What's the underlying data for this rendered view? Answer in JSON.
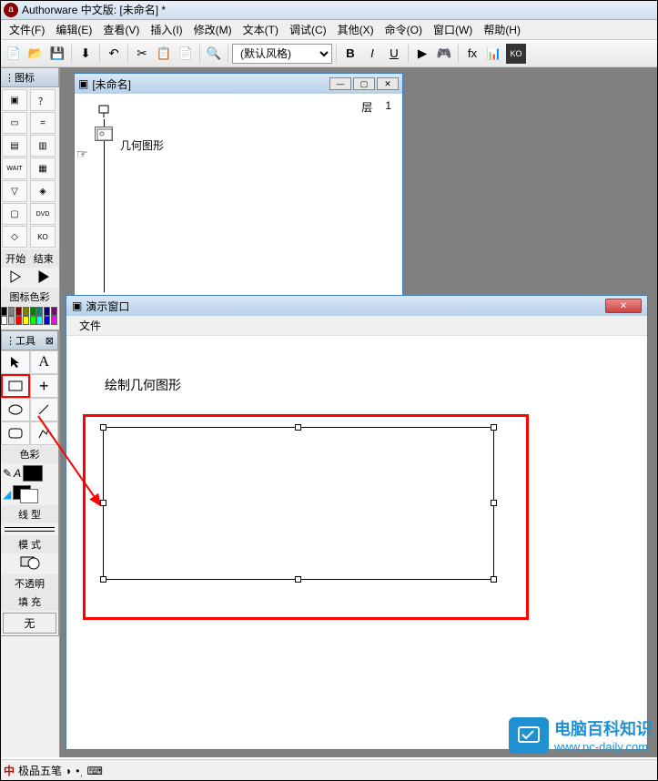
{
  "title": "Authorware 中文版: [未命名] *",
  "menus": [
    "文件(F)",
    "编辑(E)",
    "查看(V)",
    "插入(I)",
    "修改(M)",
    "文本(T)",
    "调试(C)",
    "其他(X)",
    "命令(O)",
    "窗口(W)",
    "帮助(H)"
  ],
  "style_select": "(默认风格)",
  "sidebar": {
    "icons_title": "图标",
    "start_end": {
      "start": "开始",
      "end": "结束"
    },
    "color_title": "图标色彩",
    "tools_title": "工具",
    "section_color": "色彩",
    "section_line": "线 型",
    "section_mode": "模 式",
    "mode_label": "不透明",
    "section_fill": "填 充",
    "fill_label": "无"
  },
  "flow_window": {
    "title": "[未命名]",
    "layer_label": "层",
    "layer_value": "1",
    "icon_label": "几何图形"
  },
  "demo_window": {
    "title": "演示窗口",
    "menu_file": "文件",
    "canvas_heading": "绘制几何图形"
  },
  "statusbar": {
    "ime": "极品五笔"
  },
  "watermark": {
    "cn": "电脑百科知识",
    "url": "www.pc-daily.com"
  },
  "colors": [
    "#000000",
    "#808080",
    "#800000",
    "#808000",
    "#008000",
    "#008080",
    "#000080",
    "#800080",
    "#ffffff",
    "#c0c0c0",
    "#ff0000",
    "#ffff00",
    "#00ff00",
    "#00ffff",
    "#0000ff",
    "#ff00ff"
  ]
}
